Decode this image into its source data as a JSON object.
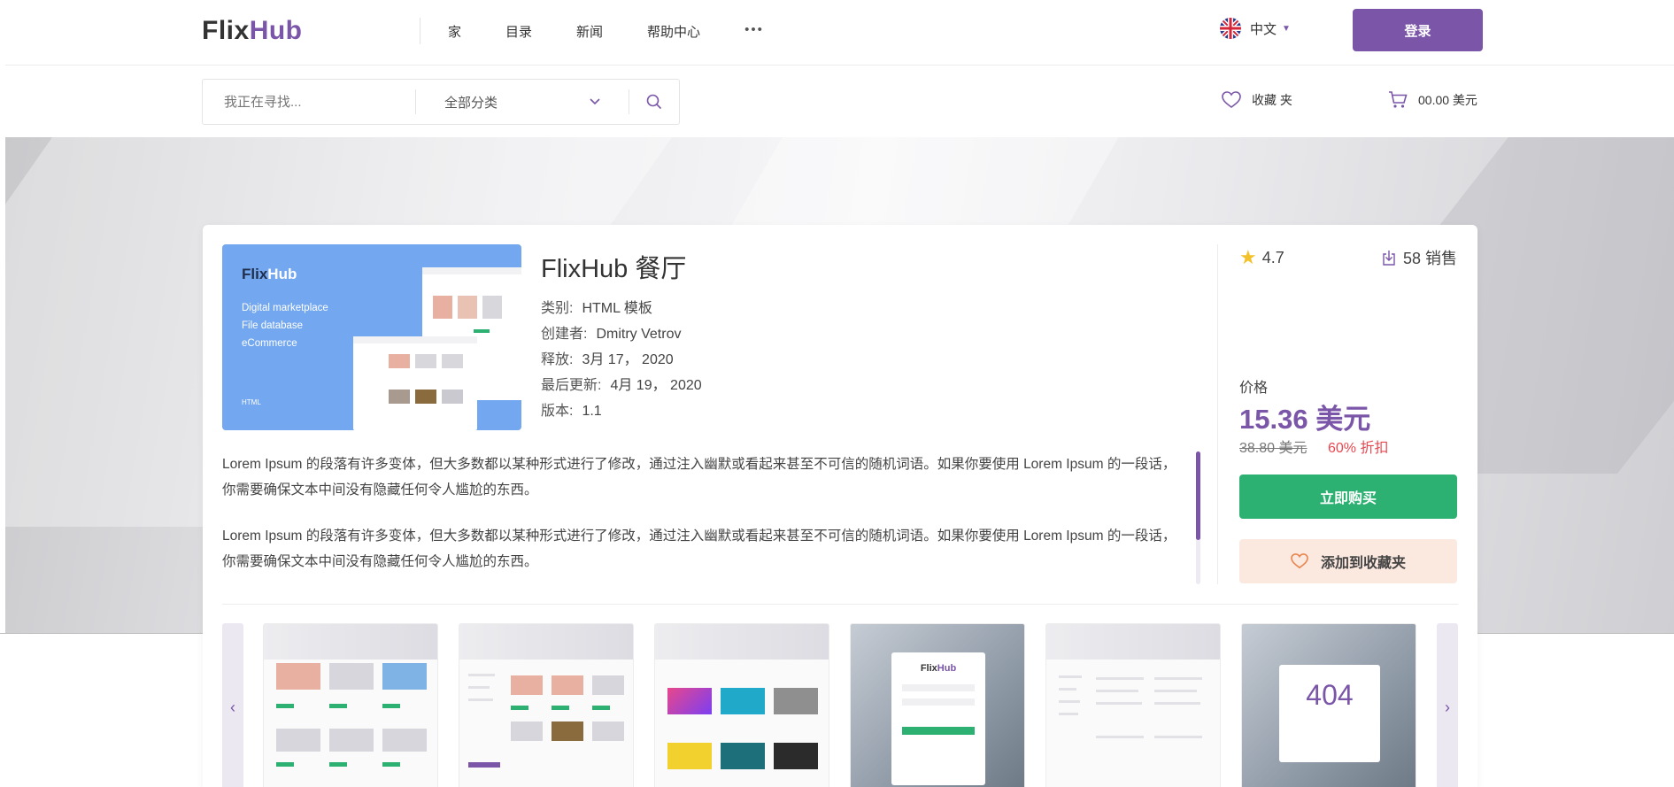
{
  "header": {
    "logo_part1": "Flix",
    "logo_part2": "Hub",
    "nav": [
      "家",
      "目录",
      "新闻",
      "帮助中心"
    ],
    "more": "•••",
    "language": "中文",
    "login_label": "登录"
  },
  "search": {
    "placeholder": "我正在寻找...",
    "category": "全部分类"
  },
  "favorites_label": "收藏 夹",
  "cart_total": "00.00 美元",
  "product": {
    "title": "FlixHub 餐厅",
    "thumbnail": {
      "brand1": "Flix",
      "brand2": "Hub",
      "lines": [
        "Digital marketplace",
        "File database",
        "eCommerce"
      ],
      "footer": "HTML"
    },
    "meta": [
      {
        "label": "类别:",
        "value": "HTML 模板"
      },
      {
        "label": "创建者:",
        "value": "Dmitry Vetrov"
      },
      {
        "label": "释放:",
        "value": "3月 17， 2020"
      },
      {
        "label": "最后更新:",
        "value": "4月 19， 2020"
      },
      {
        "label": "版本:",
        "value": "1.1"
      }
    ],
    "description": [
      "Lorem Ipsum 的段落有许多变体，但大多数都以某种形式进行了修改，通过注入幽默或看起来甚至不可信的随机词语。如果你要使用 Lorem Ipsum 的一段话，你需要确保文本中间没有隐藏任何令人尴尬的东西。",
      "Lorem Ipsum 的段落有许多变体，但大多数都以某种形式进行了修改，通过注入幽默或看起来甚至不可信的随机词语。如果你要使用 Lorem Ipsum 的一段话，你需要确保文本中间没有隐藏任何令人尴尬的东西。"
    ],
    "rating": "4.7",
    "sales": "58 销售",
    "price_label": "价格",
    "price": "15.36 美元",
    "old_price": "38.80 美元",
    "discount": "60% 折扣",
    "buy_label": "立即购买",
    "wishlist_label": "添加到收藏夹"
  },
  "gallery": {
    "login_brand1": "Flix",
    "login_brand2": "Hub",
    "error_code": "404"
  },
  "colors": {
    "accent": "#7a55a8",
    "buy": "#2db173",
    "discount": "#e9474f",
    "wishlist_bg": "#fbe8df"
  }
}
